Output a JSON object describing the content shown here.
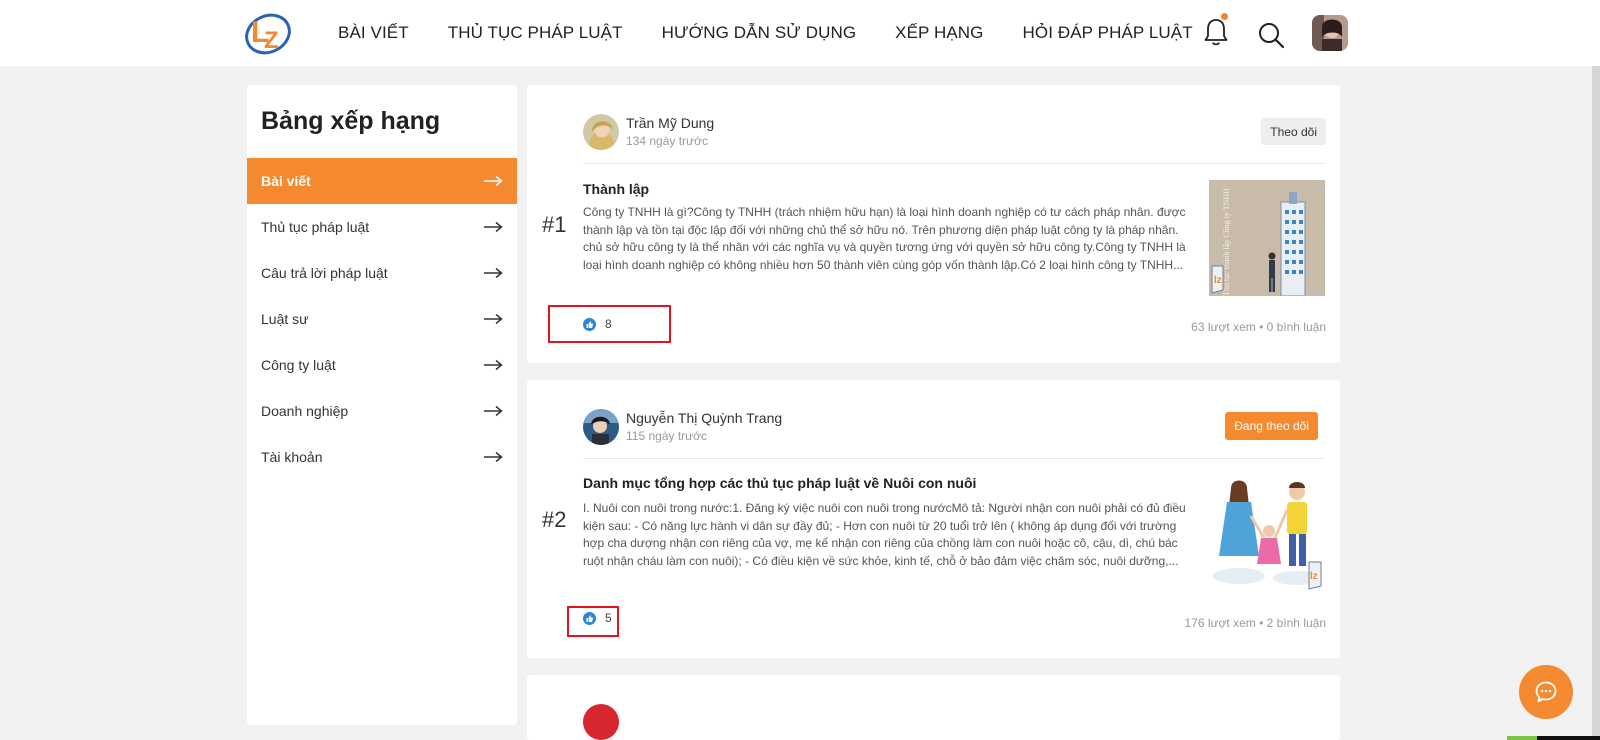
{
  "nav": {
    "items": [
      "BÀI VIẾT",
      "THỦ TỤC PHÁP LUẬT",
      "HƯỚNG DẪN SỬ DỤNG",
      "XẾP HẠNG",
      "HỎI ĐÁP PHÁP LUẬT"
    ]
  },
  "icons": {
    "logo": "lz-logo-icon",
    "bell": "bell-icon",
    "search": "search-icon",
    "arrow": "arrow-right-icon",
    "like": "like-icon",
    "chat": "chat-bubble-icon"
  },
  "colors": {
    "accent": "#f5892f",
    "highlight_box": "#e0141e",
    "like_blue": "#2b87d6"
  },
  "sidebar": {
    "title": "Bảng xếp hạng",
    "items": [
      {
        "label": "Bài viết",
        "active": true
      },
      {
        "label": "Thủ tục pháp luật",
        "active": false
      },
      {
        "label": "Câu trả lời pháp luật",
        "active": false
      },
      {
        "label": "Luật sư",
        "active": false
      },
      {
        "label": "Công ty luật",
        "active": false
      },
      {
        "label": "Doanh nghiệp",
        "active": false
      },
      {
        "label": "Tài khoản",
        "active": false
      }
    ]
  },
  "posts": [
    {
      "rank": "#1",
      "author": "Trần Mỹ Dung",
      "time": "134 ngày trước",
      "follow_label": "Theo dõi",
      "title": "Thành lập",
      "excerpt": "Công ty TNHH là gì?Công ty TNHH (trách nhiệm hữu hạn) là loại hình doanh nghiệp có tư cách pháp nhân. được thành lập và tồn tại độc lập đối với những chủ thể sở hữu nó. Trên phương diện pháp luật công ty là pháp nhân. chủ sở hữu công ty là thể nhân với các nghĩa vụ và quyền tương ứng với quyền sở hữu công ty.Công ty TNHH là loại hình doanh nghiệp có không nhiều hơn 50 thành viên cùng góp vốn thành lập.Có 2 loại hình công ty TNHH...",
      "thumb_caption": "Thủ tục thành lập Công ty TNHH",
      "likes": "8",
      "stats": "63 lượt xem • 0 bình luận"
    },
    {
      "rank": "#2",
      "author": "Nguyễn Thị Quỳnh Trang",
      "time": "115 ngày trước",
      "follow_label": "Đang theo dõi",
      "title": "Danh mục tổng hợp các thủ tục pháp luật về Nuôi con nuôi",
      "excerpt": "I. Nuôi con nuôi trong nước:1. Đăng ký việc nuôi con nuôi trong nướcMô tả: Người nhận con nuôi phải có đủ điều kiện sau: - Có năng lực hành vi dân sự đầy đủ; - Hơn con nuôi từ 20 tuổi trở lên ( không áp dụng đối với trường hợp cha dượng nhận con riêng của vợ, mẹ kế nhận con riêng của chồng làm con nuôi hoặc cô, cậu, dì, chú bác ruột nhận cháu làm con nuôi); - Có điều kiện về sức khỏe, kinh tế, chỗ ở bảo đảm việc chăm sóc, nuôi dưỡng,...",
      "likes": "5",
      "stats": "176 lượt xem • 2 bình luận"
    }
  ]
}
